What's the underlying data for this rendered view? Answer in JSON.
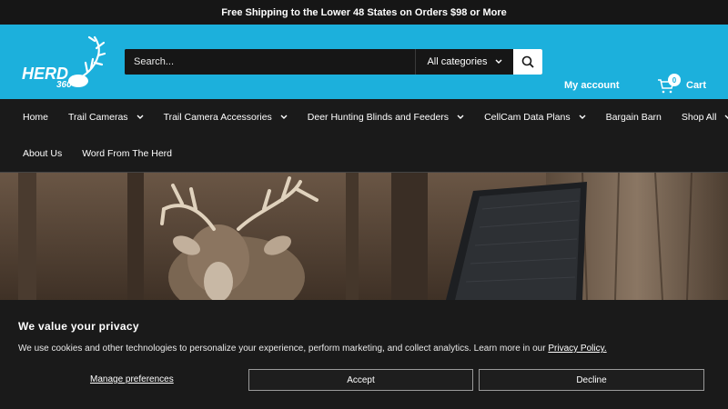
{
  "announcement": "Free Shipping to the Lower 48 States on Orders $98 or More",
  "logo": {
    "text": "HERD",
    "sub": "360"
  },
  "search": {
    "placeholder": "Search...",
    "category": "All categories"
  },
  "account": "My account",
  "cart": {
    "label": "Cart",
    "count": "0"
  },
  "nav": {
    "row1": [
      {
        "label": "Home",
        "dropdown": false
      },
      {
        "label": "Trail Cameras",
        "dropdown": true
      },
      {
        "label": "Trail Camera Accessories",
        "dropdown": true
      },
      {
        "label": "Deer Hunting Blinds and Feeders",
        "dropdown": true
      },
      {
        "label": "CellCam Data Plans",
        "dropdown": true
      },
      {
        "label": "Bargain Barn",
        "dropdown": false
      },
      {
        "label": "Shop All",
        "dropdown": true
      }
    ],
    "row2": [
      {
        "label": "About Us",
        "dropdown": false
      },
      {
        "label": "Word From The Herd",
        "dropdown": false
      }
    ]
  },
  "cookie": {
    "title": "We value your privacy",
    "text": "We use cookies and other technologies to personalize your experience, perform marketing, and collect analytics. Learn more in our",
    "link": "Privacy Policy.",
    "manage": "Manage preferences",
    "accept": "Accept",
    "decline": "Decline"
  },
  "colors": {
    "header": "#1cb0dc",
    "dark": "#1a1a1a"
  }
}
